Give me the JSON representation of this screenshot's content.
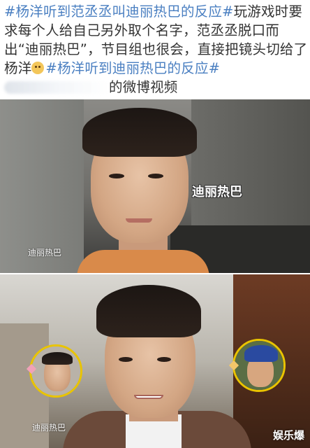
{
  "post": {
    "tag_prefix": "#杨洋听到范丞丞叫迪丽热巴的反应#",
    "text": "玩游戏时要求每个人给自己另外取个名字，范丞丞脱口而出“迪丽热巴”，节目组也很会，直接把镜头切给了杨洋",
    "tag_repeat": "#杨洋听到迪丽热巴的反应#",
    "suffix": "的微博视频"
  },
  "frame1": {
    "subtitle": "迪丽热巴",
    "corner_label": "迪丽热巴"
  },
  "frame2": {
    "corner_label": "迪丽热巴",
    "watermark": "娱乐爆"
  },
  "colors": {
    "tag": "#4a7fc1",
    "text": "#333333",
    "ring": "#e9c400"
  },
  "icons": [
    "emoji-face-icon",
    "heart-icon"
  ]
}
